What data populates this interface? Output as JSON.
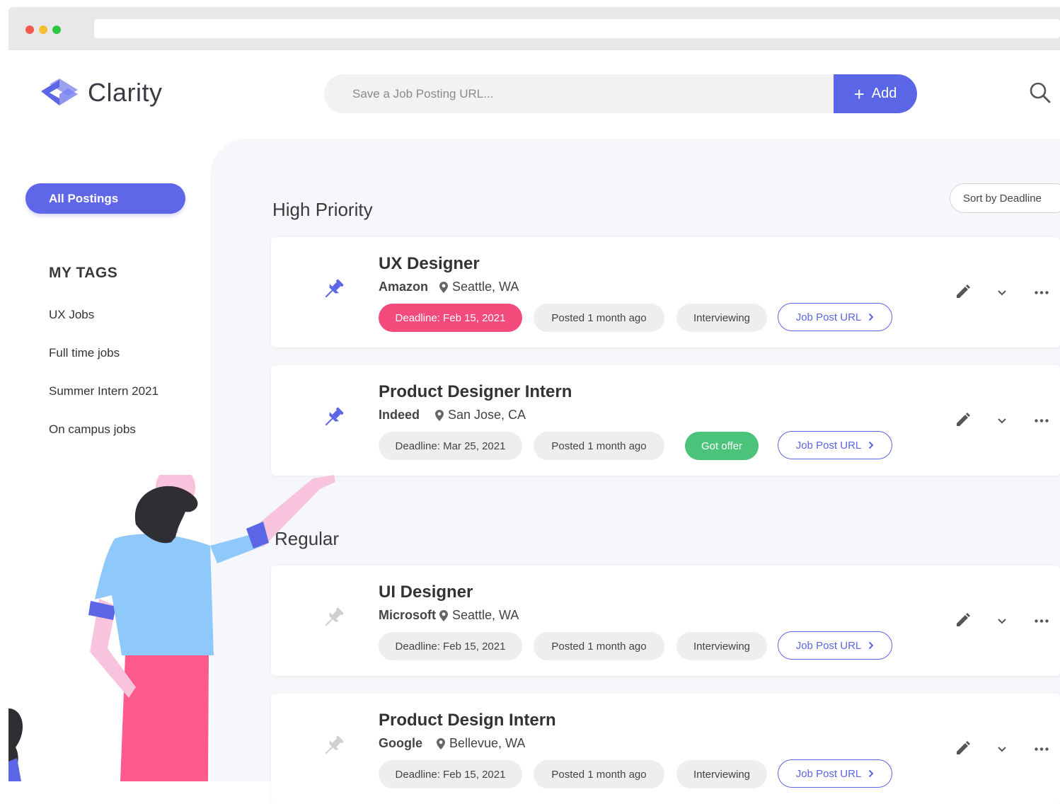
{
  "header": {
    "logo_text": "Clarity",
    "save_placeholder": "Save a Job Posting URL...",
    "add_label": "Add"
  },
  "sidebar": {
    "all_postings": "All Postings",
    "tags_title": "MY TAGS",
    "tags": [
      "UX Jobs",
      "Full time jobs",
      "Summer Intern 2021",
      "On campus jobs"
    ]
  },
  "main": {
    "sort_label": "Sort by Deadline",
    "sections": [
      {
        "title": "High Priority",
        "postings": [
          {
            "title": "UX Designer",
            "company": "Amazon",
            "location": "Seattle, WA",
            "deadline": "Deadline: Feb 15, 2021",
            "posted": "Posted 1 month ago",
            "status": "Interviewing",
            "url_label": "Job Post URL"
          },
          {
            "title": "Product Designer Intern",
            "company": "Indeed",
            "location": "San Jose, CA",
            "deadline": "Deadline: Mar 25, 2021",
            "posted": "Posted 1 month ago",
            "status": "Got offer",
            "url_label": "Job Post URL"
          }
        ]
      },
      {
        "title": "Regular",
        "postings": [
          {
            "title": "UI Designer",
            "company": "Microsoft",
            "location": "Seattle, WA",
            "deadline": "Deadline: Feb 15, 2021",
            "posted": "Posted 1 month ago",
            "status": "Interviewing",
            "url_label": "Job Post URL"
          },
          {
            "title": "Product Design Intern",
            "company": "Google",
            "location": "Bellevue, WA",
            "deadline": "Deadline: Feb 15, 2021",
            "posted": "Posted 1 month ago",
            "status": "Interviewing",
            "url_label": "Job Post URL"
          }
        ]
      }
    ]
  },
  "colors": {
    "accent": "#5b66e6",
    "deadline_urgent": "#f24b7c",
    "offer": "#4bc37a",
    "chip_bg": "#eeeeee",
    "content_bg": "#f6f7fa"
  },
  "icons": [
    "search-icon",
    "plus-icon",
    "pin-icon",
    "location-pin-icon",
    "pencil-icon",
    "chevron-down-icon",
    "more-dots-icon",
    "chevron-right-icon"
  ]
}
